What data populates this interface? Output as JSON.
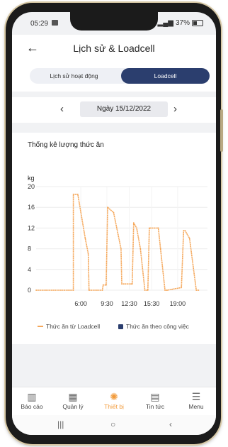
{
  "status": {
    "time": "05:29",
    "battery": "37%"
  },
  "header": {
    "title": "Lịch sử & Loadcell"
  },
  "tabs": [
    {
      "label": "Lịch sử hoạt động"
    },
    {
      "label": "Loadcell"
    }
  ],
  "date": {
    "label": "Ngày 15/12/2022"
  },
  "chart_data": {
    "type": "line",
    "title": "Thống kê lượng thức ăn",
    "ylabel": "kg",
    "ylim": [
      0,
      20
    ],
    "yticks": [
      "0",
      "4",
      "8",
      "12",
      "16",
      "20"
    ],
    "xticks": [
      {
        "t": 6.0,
        "label": "6:00"
      },
      {
        "t": 9.5,
        "label": "9:30"
      },
      {
        "t": 12.5,
        "label": "12:30"
      },
      {
        "t": 15.5,
        "label": "15:30"
      },
      {
        "t": 19.0,
        "label": "19:00"
      }
    ],
    "xlim": [
      0.0,
      23.0
    ],
    "series": [
      {
        "name": "Thức ăn từ Loadcell",
        "color": "#f5a75a",
        "x": [
          0.0,
          5.0,
          5.0,
          5.6,
          6.6,
          7.0,
          7.1,
          8.9,
          9.0,
          9.4,
          9.6,
          10.4,
          11.4,
          11.5,
          12.9,
          13.1,
          13.5,
          14.0,
          14.6,
          15.0,
          15.2,
          16.4,
          16.7,
          17.3,
          17.5,
          17.6,
          19.5,
          19.8,
          20.0,
          20.6,
          21.5,
          21.8
        ],
        "y": [
          0,
          0,
          18.5,
          18.5,
          10,
          7,
          0,
          0,
          1,
          1,
          16,
          15,
          8,
          1.2,
          1.2,
          13,
          12,
          8,
          0,
          0,
          12,
          12,
          8,
          0,
          0,
          0,
          0.5,
          11.5,
          11.5,
          10,
          0,
          0
        ]
      },
      {
        "name": "Thức ăn theo công việc",
        "color": "#2b3e6e",
        "x": [],
        "y": []
      }
    ]
  },
  "nav": [
    {
      "label": "Báo cáo"
    },
    {
      "label": "Quản lý"
    },
    {
      "label": "Thiết bị"
    },
    {
      "label": "Tin tức"
    },
    {
      "label": "Menu"
    }
  ],
  "colors": {
    "accent": "#2b3e6e",
    "active_nav": "#f29b3b",
    "line": "#f5a75a"
  }
}
